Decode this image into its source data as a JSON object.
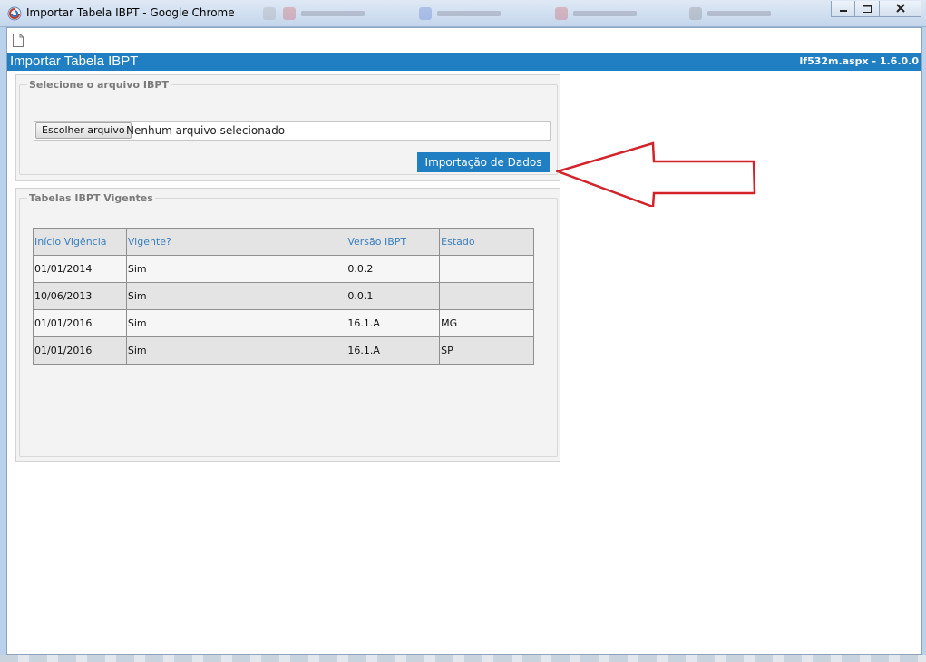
{
  "window": {
    "title": "Importar Tabela IBPT - Google Chrome"
  },
  "header": {
    "title": "Importar Tabela IBPT",
    "version": "lf532m.aspx - 1.6.0.0"
  },
  "upload": {
    "legend": "Selecione o arquivo IBPT",
    "choose_button": "Escolher arquivo",
    "no_file_text": "Nenhum arquivo selecionado",
    "import_button": "Importação de Dados"
  },
  "tables": {
    "legend": "Tabelas IBPT Vigentes",
    "columns": [
      "Início Vigência",
      "Vigente?",
      "Versão IBPT",
      "Estado"
    ],
    "rows": [
      [
        "01/01/2014",
        "Sim",
        "0.0.2",
        ""
      ],
      [
        "10/06/2013",
        "Sim",
        "0.0.1",
        ""
      ],
      [
        "01/01/2016",
        "Sim",
        "16.1.A",
        "MG"
      ],
      [
        "01/01/2016",
        "Sim",
        "16.1.A",
        "SP"
      ]
    ]
  },
  "colors": {
    "accent": "#1f7fc2",
    "arrow": "#d2232a",
    "header_text": "#3a7fc0"
  }
}
